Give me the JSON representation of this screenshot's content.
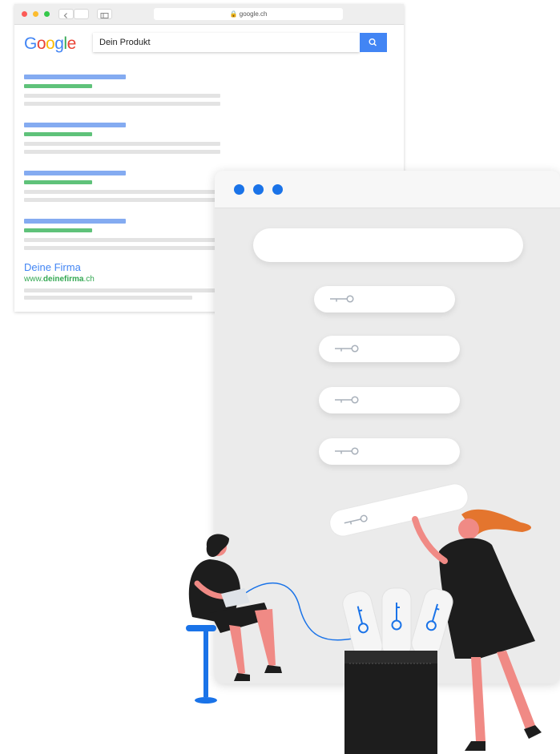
{
  "serp_browser": {
    "url": "google.ch",
    "logo_text": "Google",
    "search_query": "Dein Produkt",
    "highlighted_result": {
      "title": "Deine Firma",
      "url_prefix": "www.",
      "url_bold": "deinefirma",
      "url_suffix": ".ch"
    }
  },
  "colors": {
    "google_blue": "#4285f4",
    "google_red": "#ea4335",
    "google_yellow": "#fbbc05",
    "google_green": "#34a853",
    "accent_blue": "#1a73e8",
    "illustration_black": "#1d1d1d",
    "illustration_skin": "#f08a85",
    "illustration_hair": "#e4752e"
  },
  "icons": [
    "lock-icon",
    "search-icon",
    "sidebar-icon",
    "chevron-left-icon",
    "key-icon"
  ]
}
